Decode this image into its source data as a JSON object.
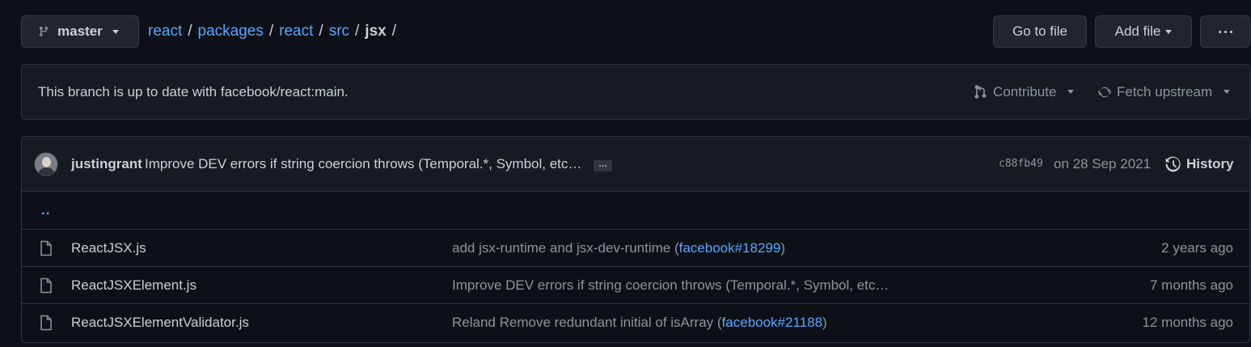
{
  "branch": {
    "name": "master"
  },
  "breadcrumb": {
    "items": [
      "react",
      "packages",
      "react",
      "src"
    ],
    "current": "jsx",
    "separator": "/"
  },
  "toolbar": {
    "go_to_file": "Go to file",
    "add_file": "Add file"
  },
  "branch_status": {
    "message": "This branch is up to date with facebook/react:main.",
    "contribute": "Contribute",
    "fetch_upstream": "Fetch upstream"
  },
  "latest_commit": {
    "author": "justingrant",
    "message": "Improve DEV errors if string coercion throws (Temporal.*, Symbol, etc…",
    "ellipsis": "…",
    "sha": "c88fb49",
    "date": "on 28 Sep 2021",
    "history": "History"
  },
  "parent_dir": "..",
  "files": [
    {
      "name": "ReactJSX.js",
      "message": "add jsx-runtime and jsx-dev-runtime (",
      "pr": "facebook#18299",
      "message_end": ")",
      "age": "2 years ago"
    },
    {
      "name": "ReactJSXElement.js",
      "message": "Improve DEV errors if string coercion throws (Temporal.*, Symbol, etc…",
      "pr": "",
      "message_end": "",
      "age": "7 months ago"
    },
    {
      "name": "ReactJSXElementValidator.js",
      "message": "Reland Remove redundant initial of isArray (",
      "pr": "facebook#21188",
      "message_end": ")",
      "age": "12 months ago"
    }
  ],
  "colors": {
    "background": "#0d1117",
    "panel": "#161b22",
    "border": "#30363d",
    "link": "#58a6ff",
    "text": "#c9d1d9",
    "muted": "#8b949e"
  }
}
